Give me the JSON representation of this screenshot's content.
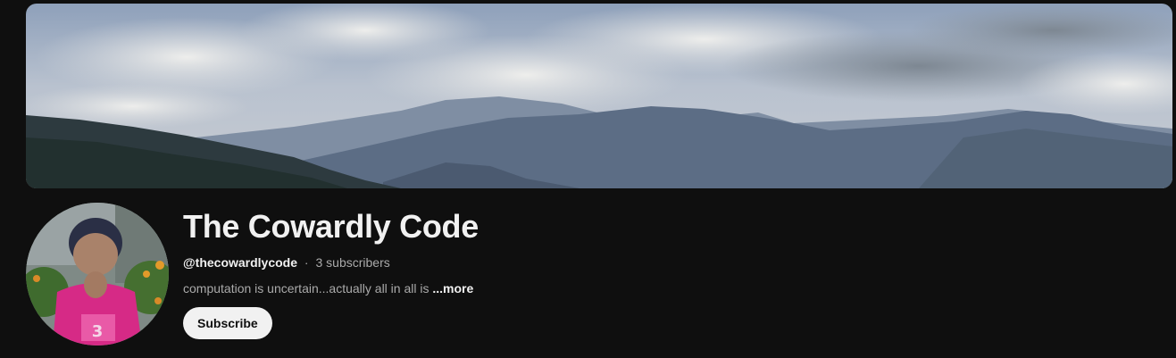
{
  "channel": {
    "title": "The Cowardly Code",
    "handle": "@thecowardlycode",
    "separator": "·",
    "subscribers": "3 subscribers",
    "description": "computation is uncertain...actually all in all is ",
    "more_label": "...more",
    "subscribe_label": "Subscribe"
  },
  "colors": {
    "background": "#0f0f0f",
    "title": "#f1f1f1",
    "secondary_text": "#aaaaaa",
    "subscribe_bg": "#f1f1f1",
    "subscribe_text": "#0f0f0f"
  },
  "images": {
    "banner": "mountain-landscape-banner",
    "avatar": "child-profile-photo"
  }
}
